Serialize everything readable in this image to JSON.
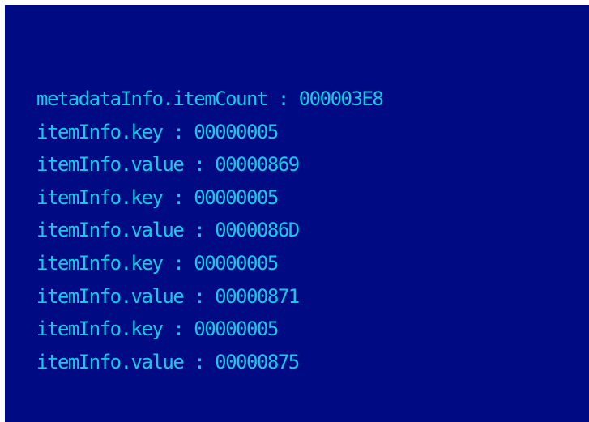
{
  "colors": {
    "background": "#000b83",
    "text": "#17c9e8"
  },
  "console": {
    "lines": [
      "metadataInfo.itemCount : 000003E8",
      "itemInfo.key : 00000005",
      "itemInfo.value : 00000869",
      "itemInfo.key : 00000005",
      "itemInfo.value : 0000086D",
      "itemInfo.key : 00000005",
      "itemInfo.value : 00000871",
      "itemInfo.key : 00000005",
      "itemInfo.value : 00000875"
    ]
  }
}
